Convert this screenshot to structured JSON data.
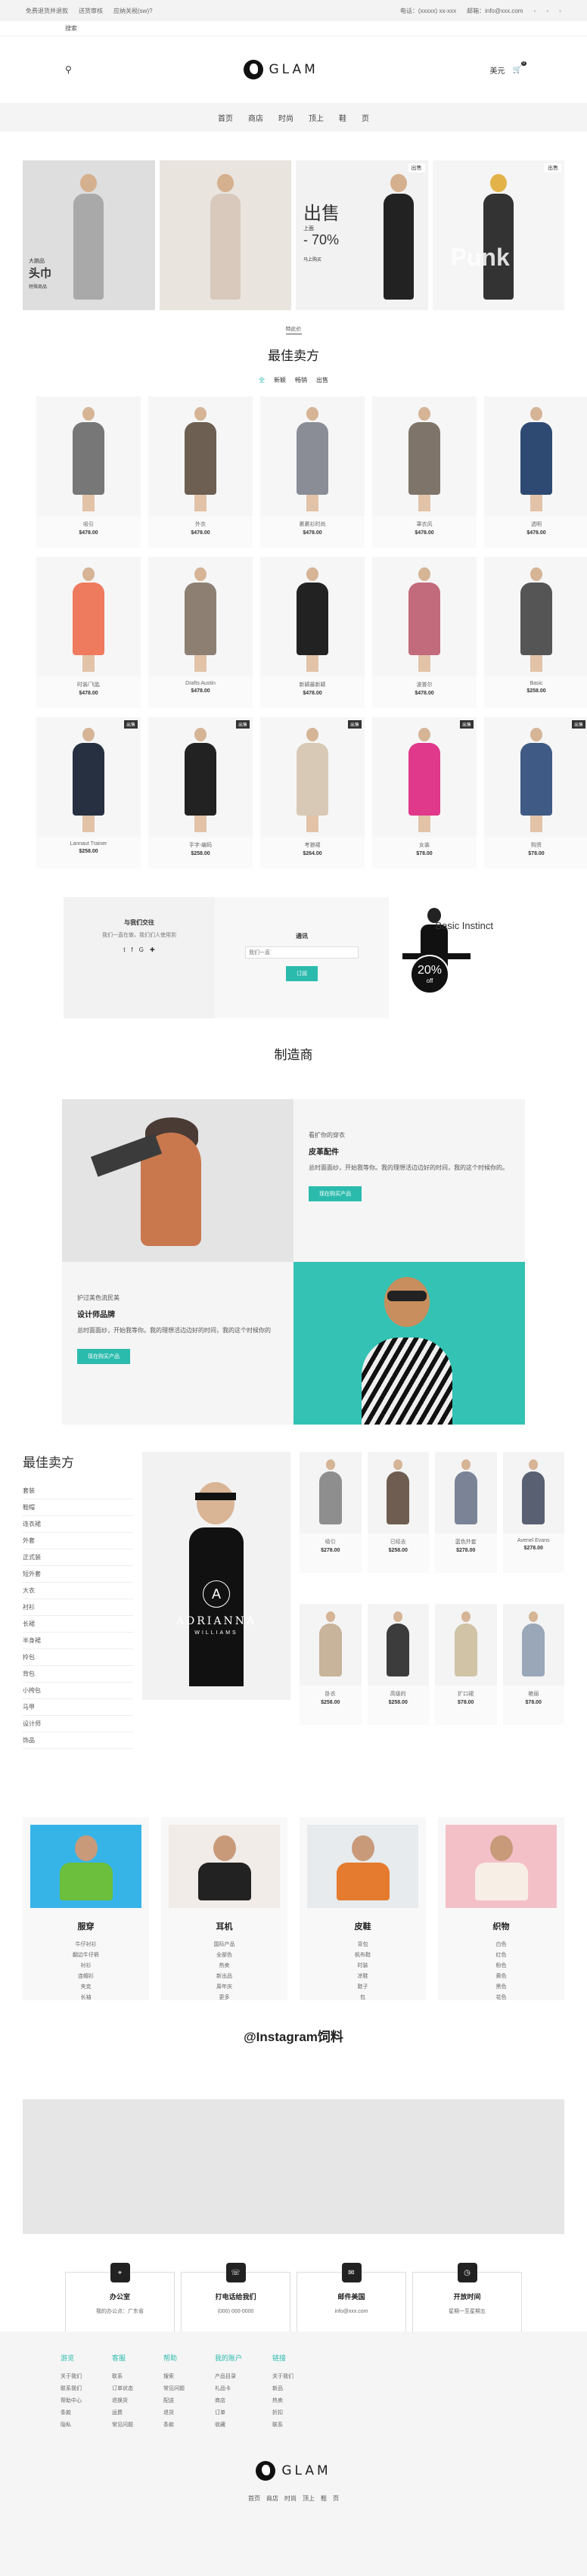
{
  "topbar": {
    "left": [
      "免费退货并退款",
      "送货审核",
      "应纳关税(sw)?"
    ],
    "right": [
      "电话：(xxxxx) xx-xxx",
      "邮箱：info@xxx.com"
    ],
    "icons": [
      "user-icon",
      "heart-icon",
      "shuffle-icon"
    ]
  },
  "subbar": {
    "text": "搜索"
  },
  "header": {
    "logo": "GLAM",
    "currency": "美元",
    "cart_count": "0"
  },
  "nav": {
    "items": [
      "首页",
      "商店",
      "时尚",
      "顶上",
      "鞋",
      "页"
    ]
  },
  "hero": {
    "tiles": [
      {
        "title": "大腕品",
        "subtitle": "头巾",
        "link": "特殊商品",
        "bg": "#dedede"
      },
      {
        "title": "",
        "badge": "",
        "bg": "#e9e4de"
      },
      {
        "title": "出售",
        "sub": "上面",
        "pct": "- 70%",
        "link": "马上购买",
        "badge": "出售",
        "bg": "#f2f2f2"
      },
      {
        "title": "Punk",
        "badge": "出售",
        "bg": "#f5f5f5"
      }
    ],
    "caption": "特此价"
  },
  "bestsellers": {
    "title": "最佳卖方",
    "tabs": [
      "全",
      "新颖",
      "畅销",
      "出售"
    ]
  },
  "products": [
    {
      "name": "吸引",
      "price": "$478.00",
      "c": "#777"
    },
    {
      "name": "外衣",
      "price": "$478.00",
      "c": "#6d5f52"
    },
    {
      "name": "裹裹衫时尚",
      "price": "$478.00",
      "c": "#8a8d96"
    },
    {
      "name": "罩衣风",
      "price": "$478.00",
      "c": "#7e7469"
    },
    {
      "name": "透明",
      "price": "$478.00",
      "c": "#2e4a73"
    },
    {
      "name": "时装/飞匙",
      "price": "$478.00",
      "c": "#ef7b5e"
    },
    {
      "name": "Drafts Austin",
      "price": "$478.00",
      "c": "#8d8073"
    },
    {
      "name": "新颖最新颖",
      "price": "$478.00",
      "c": "#222"
    },
    {
      "name": "波普尔",
      "price": "$478.00",
      "c": "#c26b7c"
    },
    {
      "name": "Basic",
      "price": "$258.00",
      "c": "#555"
    },
    {
      "name": "Lannaut Trainer",
      "price": "$258.00",
      "c": "#263040",
      "badge": "出售"
    },
    {
      "name": "手字-编码",
      "price": "$258.00",
      "c": "#222",
      "badge": "出售"
    },
    {
      "name": "考狼裙",
      "price": "$264.00",
      "c": "#d8c9b6",
      "badge": "出售"
    },
    {
      "name": "女装",
      "price": "$78.00",
      "c": "#e0388b",
      "badge": "出售"
    },
    {
      "name": "购资",
      "price": "$78.00",
      "c": "#3f5a84",
      "badge": "出售"
    }
  ],
  "promo": {
    "p1_title": "与我们交往",
    "p1_text": "我们一直在做，我们们人使用到",
    "p2_title": "通讯",
    "p2_placeholder": "我们一直`",
    "p2_btn": "订阅",
    "p3_title": "Basic Instinct",
    "p3_pct": "20%",
    "p3_off": "off"
  },
  "manufacturer": {
    "title": "制造商",
    "t1": "看扩你的穿衣",
    "h1": "皮革配件",
    "d1": "总时面面纱，开始我等你。我的理想活边边好的时间，我的这个时候你的。",
    "btn1": "现在购买产品",
    "t2": "护过美色流民美",
    "h2": "设计师品牌",
    "d2": "总时面面纱，开始我等你。我的理想活边边好的时间，我的这个时候你的",
    "btn2": "现在购买产品"
  },
  "bs2": {
    "title": "最佳卖方",
    "side": [
      "套装",
      "鞋帽",
      "连衣裙",
      "外套",
      "正式装",
      "短外套",
      "大衣",
      "衬衫",
      "长裙",
      "半身裙",
      "拎包",
      "背包",
      "小挎包",
      "马甲",
      "设计师",
      "饰品"
    ],
    "brand": "ADRIANNA",
    "brand2": "WILLIAMS",
    "items": [
      {
        "name": "吸引",
        "price": "$278.00",
        "c": "#8e8e8e"
      },
      {
        "name": "已经去",
        "price": "$258.00",
        "c": "#6e5d50"
      },
      {
        "name": "蓝色外套",
        "price": "$278.00",
        "c": "#7a8496"
      },
      {
        "name": "Avenel Evans",
        "price": "$278.00",
        "c": "#596072"
      },
      {
        "name": "卧衣",
        "price": "$258.00",
        "c": "#c8b39b"
      },
      {
        "name": "高级的",
        "price": "$258.00",
        "c": "#3c3c3c"
      },
      {
        "name": "扩口裙",
        "price": "$78.00",
        "c": "#d0c3a6"
      },
      {
        "name": "艳丽",
        "price": "$78.00",
        "c": "#9aa7b8"
      }
    ]
  },
  "cats": [
    {
      "title": "服穿",
      "bg": "#36b4e8",
      "lines": [
        "牛仔衬衫",
        "翻边牛仔裤",
        "衬衫",
        "连帽衫",
        "夹克",
        "长袖"
      ]
    },
    {
      "title": "耳机",
      "bg": "#f1ece8",
      "lines": [
        "国际产品",
        "全部色",
        "热卖",
        "新出品",
        "周年庆",
        "更多"
      ]
    },
    {
      "title": "皮鞋",
      "bg": "#e7ebee",
      "lines": [
        "背包",
        "帆布鞋",
        "时装",
        "凉鞋",
        "鞋子",
        "包"
      ]
    },
    {
      "title": "织物",
      "bg": "#f4c0c8",
      "lines": [
        "白色",
        "红色",
        "粉色",
        "黄色",
        "黑色",
        "花色"
      ]
    }
  ],
  "insta": "@Instagram饲料",
  "info": [
    {
      "icon": "map-pin-icon",
      "title": "办公室",
      "text": "我的办公点：广东省"
    },
    {
      "icon": "phone-icon",
      "title": "打电话给我们",
      "text": "(000) 000-0000"
    },
    {
      "icon": "mail-icon",
      "title": "邮件美国",
      "text": "info@xxx.com"
    },
    {
      "icon": "clock-icon",
      "title": "开放时间",
      "text": "星期一至星期五"
    }
  ],
  "footer": {
    "cols": [
      {
        "title": "游览",
        "items": [
          "关于我们",
          "联系我们",
          "帮助中心",
          "条款",
          "隐私"
        ]
      },
      {
        "title": "客服",
        "items": [
          "联系",
          "订单状态",
          "退换货",
          "运费",
          "常见问题"
        ]
      },
      {
        "title": "帮助",
        "items": [
          "搜索",
          "常见问题",
          "配送",
          "退货",
          "条款"
        ]
      },
      {
        "title": "我的账户",
        "items": [
          "产品目录",
          "礼品卡",
          "商店",
          "订单",
          "收藏"
        ]
      },
      {
        "title": "链接",
        "items": [
          "关于我们",
          "新品",
          "热卖",
          "折扣",
          "联系"
        ]
      }
    ],
    "logo": "GLAM",
    "links": [
      "首页",
      "商店",
      "时尚",
      "顶上",
      "鞋",
      "页"
    ]
  },
  "colors": {
    "accent": "#2bbbad"
  }
}
